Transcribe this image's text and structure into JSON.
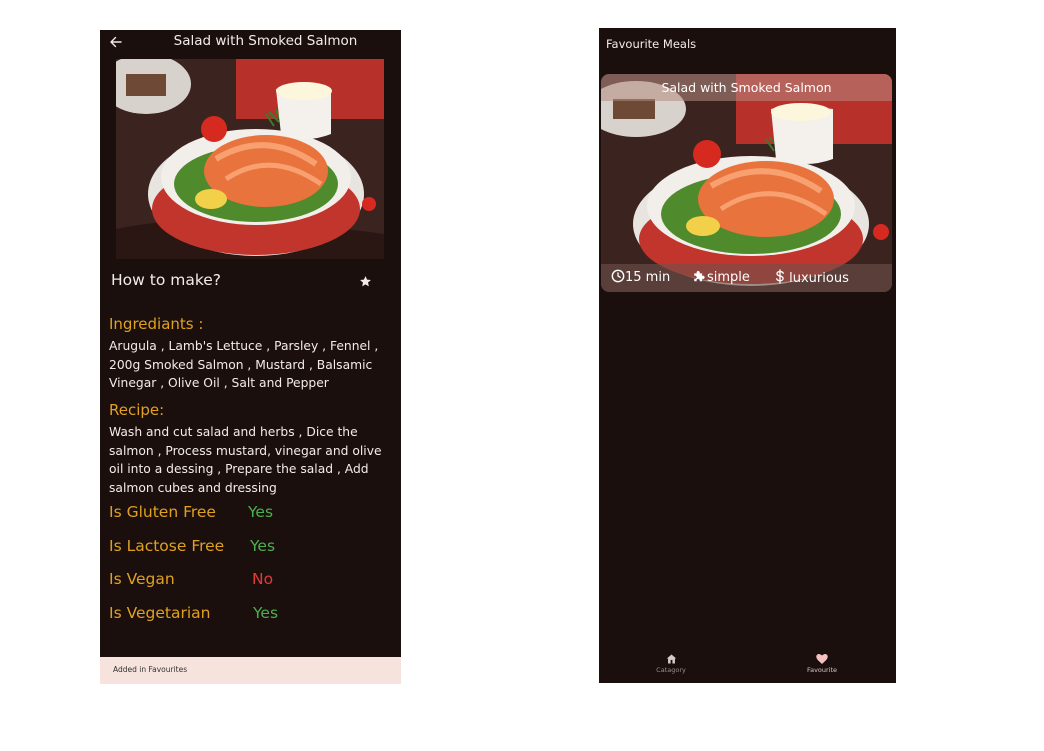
{
  "detail_screen": {
    "title": "Salad with Smoked Salmon",
    "back_icon": "arrow-left-icon",
    "how_to_label": "How to make?",
    "favourite_icon": "star-icon",
    "ingredients_title": "Ingrediants :",
    "ingredients_text": "Arugula , Lamb's Lettuce , Parsley , Fennel , 200g Smoked Salmon , Mustard , Balsamic Vinegar , Olive Oil , Salt and Pepper",
    "recipe_title": "Recipe:",
    "recipe_text": "Wash and cut salad and herbs , Dice the salmon , Process mustard, vinegar and olive oil into a dessing , Prepare the salad , Add salmon cubes and dressing",
    "flags": [
      {
        "label": "Is Gluten Free",
        "value": "Yes"
      },
      {
        "label": "Is Lactose Free",
        "value": "Yes"
      },
      {
        "label": "Is Vegan",
        "value": "No"
      },
      {
        "label": "Is Vegetarian",
        "value": "Yes"
      }
    ],
    "snackbar_text": "Added in Favourites"
  },
  "favourites_screen": {
    "title": "Favourite Meals",
    "meal_card": {
      "title": "Salad with Smoked Salmon",
      "duration": "15 min",
      "complexity": "simple",
      "affordability": "luxurious"
    },
    "bottom_nav": [
      {
        "label": "Catagory",
        "icon": "home-icon"
      },
      {
        "label": "Favourite",
        "icon": "heart-icon"
      }
    ]
  },
  "colors": {
    "background": "#1b0f0e",
    "accent": "#e0a120",
    "yes": "#4caf50",
    "no": "#e53935",
    "snackbar": "#f6e3de"
  }
}
